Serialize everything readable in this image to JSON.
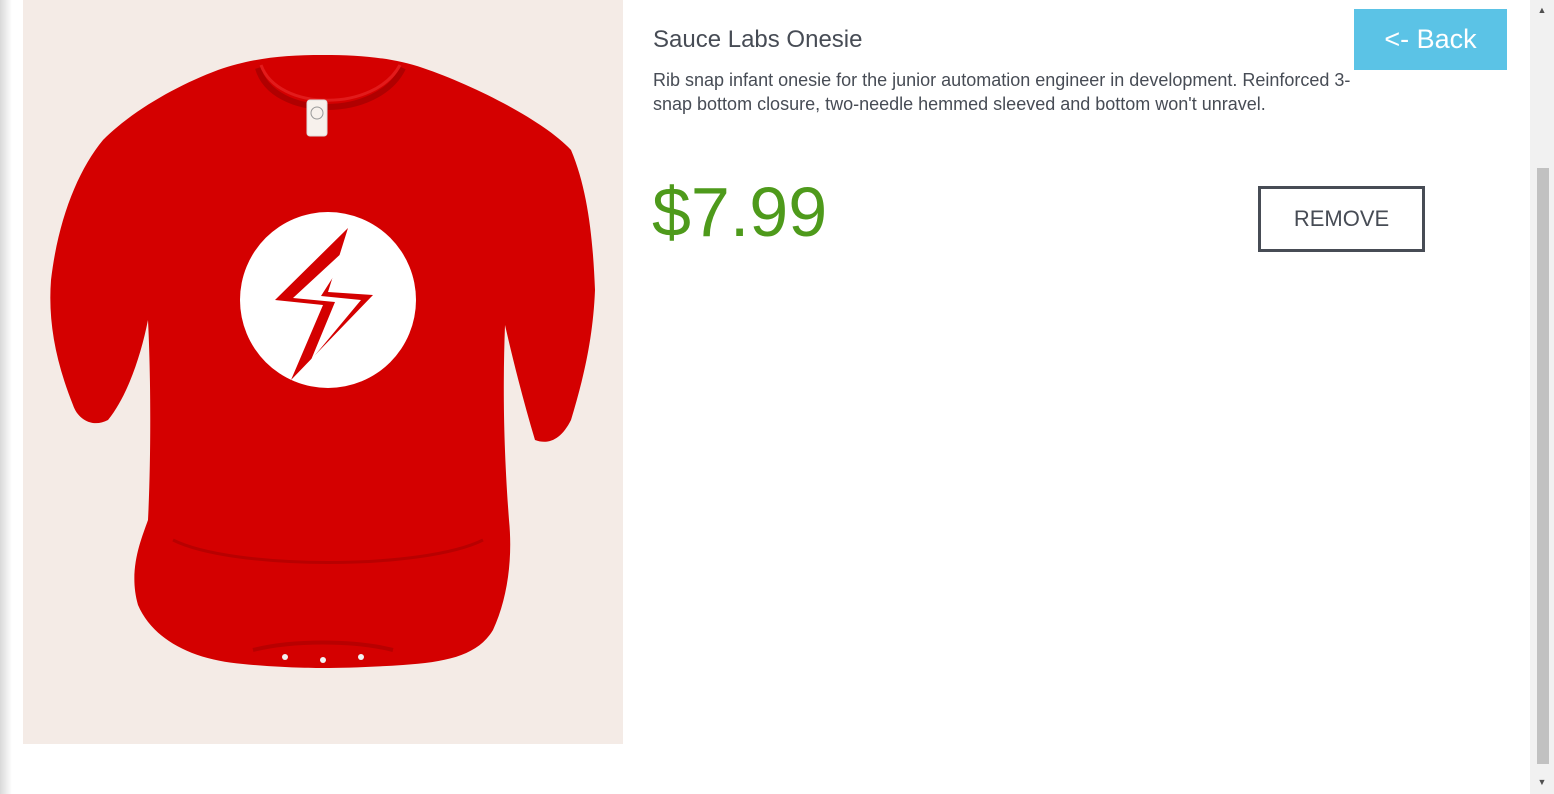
{
  "product": {
    "name": "Sauce Labs Onesie",
    "description": "Rib snap infant onesie for the junior automation engineer in development. Reinforced 3-snap bottom closure, two-needle hemmed sleeved and bottom won't unravel.",
    "price": "$7.99",
    "image_icon": "red-onesie-lightning-logo",
    "colors": {
      "price": "#4e9a1b",
      "garment": "#d40000",
      "text": "#474c55"
    }
  },
  "actions": {
    "remove_label": "REMOVE",
    "back_label": "<- Back"
  },
  "colors": {
    "back_button": "#5bc3e6"
  }
}
